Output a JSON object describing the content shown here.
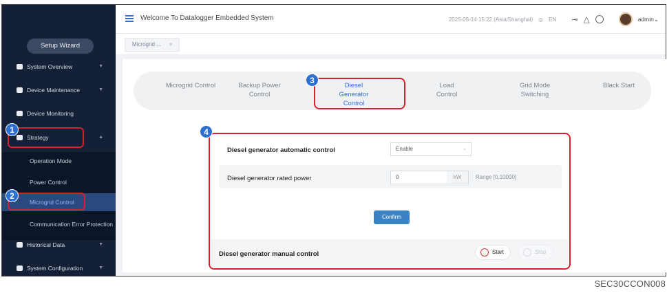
{
  "header": {
    "title": "Welcome To Datalogger Embedded System",
    "datetime": "2025-05-14 15:22 (Asia/Shanghai)",
    "language": "EN",
    "user": "admin"
  },
  "sidebar": {
    "wizard_label": "Setup Wizard",
    "items": [
      {
        "label": "System Overview"
      },
      {
        "label": "Device Maintenance"
      },
      {
        "label": "Device Monitoring"
      },
      {
        "label": "Strategy"
      },
      {
        "label": "Historical Data"
      },
      {
        "label": "System Configuration"
      }
    ],
    "strategy_sub": [
      {
        "label": "Operation Mode"
      },
      {
        "label": "Power Control"
      },
      {
        "label": "Microgrid Control"
      },
      {
        "label": "Communication Error Protection"
      }
    ]
  },
  "tabbar": {
    "tab_label": "Microgrid ...",
    "close": "×"
  },
  "subtabs": [
    {
      "label": "Microgrid Control"
    },
    {
      "label": "Backup Power Control"
    },
    {
      "label": "Diesel Generator Control"
    },
    {
      "label": "Load Control"
    },
    {
      "label": "Grid Mode Switching"
    },
    {
      "label": "Black Start"
    }
  ],
  "form": {
    "auto_label": "Diesel generator automatic control",
    "auto_value": "Enable",
    "power_label": "Diesel generator rated power",
    "power_value": "0",
    "power_unit": "kW",
    "power_range": "Range [0,10000]",
    "confirm_label": "Confirm",
    "manual_label": "Diesel generator manual control",
    "start_label": "Start",
    "stop_label": "Stop"
  },
  "annotations": {
    "n1": "1",
    "n2": "2",
    "n3": "3",
    "n4": "4",
    "color": "#d6222e",
    "badge_color": "#2b6fd1"
  },
  "footer_code": "SEC30CCON008"
}
